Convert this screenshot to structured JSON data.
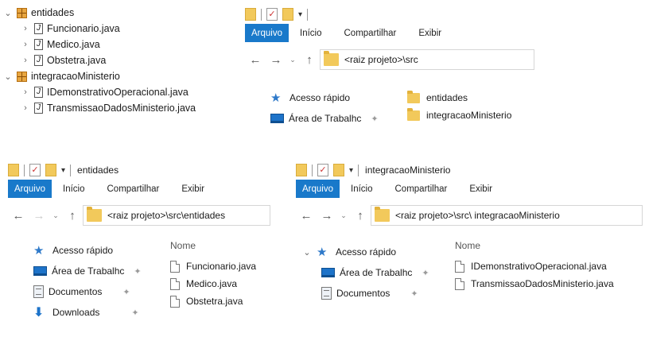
{
  "tree": {
    "packages": [
      {
        "name": "entidades",
        "files": [
          "Funcionario.java",
          "Medico.java",
          "Obstetra.java"
        ]
      },
      {
        "name": "integracaoMinisterio",
        "files": [
          "IDemonstrativoOperacional.java",
          "TransmissaoDadosMinisterio.java"
        ]
      }
    ],
    "file_icon_letter": "J"
  },
  "ribbon_tabs": [
    "Arquivo",
    "Início",
    "Compartilhar",
    "Exibir"
  ],
  "nav": {
    "quick_access": "Acesso rápido",
    "desktop": "Área de Trabalhc",
    "documents": "Documentos",
    "downloads": "Downloads"
  },
  "column_name": "Nome",
  "win_src": {
    "title": "",
    "path": "<raiz projeto>\\src",
    "items": [
      "entidades",
      "integracaoMinisterio"
    ]
  },
  "win_entidades": {
    "title": "entidades",
    "path": "<raiz projeto>\\src\\entidades",
    "files": [
      "Funcionario.java",
      "Medico.java",
      "Obstetra.java"
    ]
  },
  "win_integracao": {
    "title": "integracaoMinisterio",
    "path": "<raiz projeto>\\src\\ integracaoMinisterio",
    "files": [
      "IDemonstrativoOperacional.java",
      "TransmissaoDadosMinisterio.java"
    ]
  },
  "colors": {
    "accent": "#1979ca",
    "folder": "#f2c95b"
  }
}
